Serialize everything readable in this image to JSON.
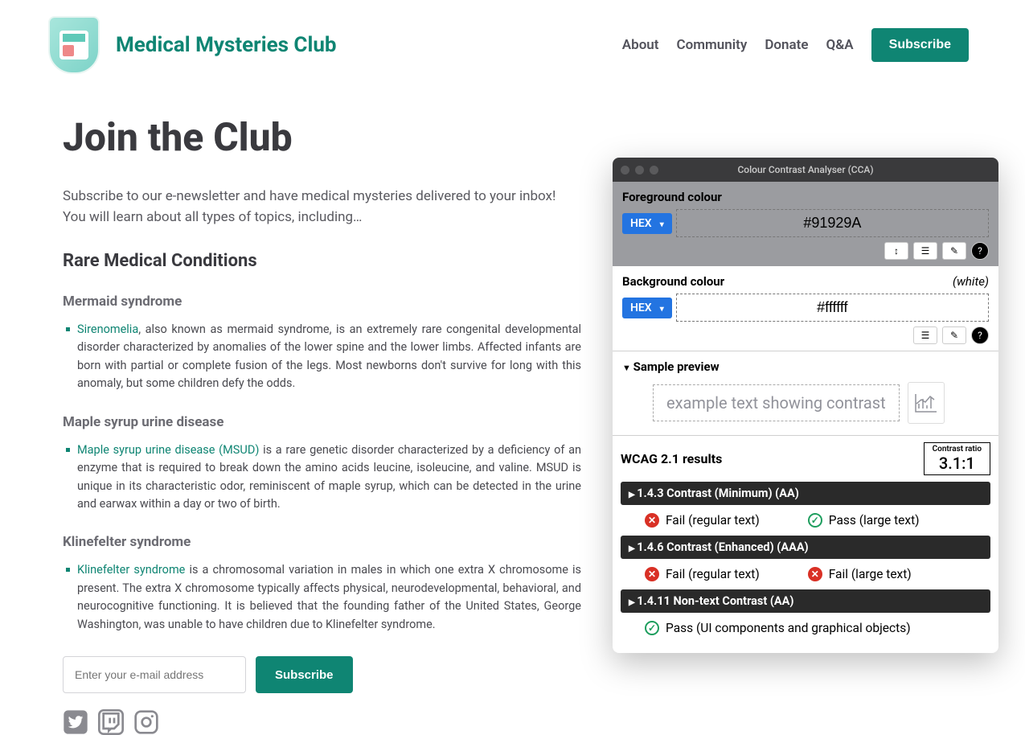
{
  "brand": {
    "name": "Medical Mysteries Club"
  },
  "nav": {
    "about": "About",
    "community": "Community",
    "donate": "Donate",
    "qa": "Q&A",
    "subscribe": "Subscribe"
  },
  "page": {
    "title": "Join the Club",
    "subtitle": "Subscribe to our e-newsletter and have medical mysteries delivered to your inbox! You will learn about all types of topics, including…",
    "section_heading": "Rare Medical Conditions"
  },
  "conditions": [
    {
      "name": "Mermaid syndrome",
      "link_text": "Sirenomelia",
      "body": ", also known as mermaid syndrome, is an extremely rare congenital developmental disorder characterized by anomalies of the lower spine and the lower limbs. Affected infants are born with partial or complete fusion of the legs. Most newborns don't survive for long with this anomaly, but some children defy the odds."
    },
    {
      "name": "Maple syrup urine disease",
      "link_text": "Maple syrup urine disease (MSUD)",
      "body": " is a rare genetic disorder characterized by a deficiency of an enzyme that is required to break down the amino acids leucine, isoleucine, and valine. MSUD is unique in its characteristic odor, reminiscent of maple syrup, which can be detected in the urine and earwax within a day or two of birth."
    },
    {
      "name": "Klinefelter syndrome",
      "link_text": "Klinefelter syndrome",
      "body": " is a chromosomal variation in males in which one extra X chromosome is present. The extra X chromosome typically affects physical, neurodevelopmental, behavioral, and neurocognitive functioning. It is believed that the founding father of the United States, George Washington, was unable to have children due to Klinefelter syndrome."
    }
  ],
  "form": {
    "email_placeholder": "Enter your e-mail address",
    "subscribe_label": "Subscribe"
  },
  "cca": {
    "window_title": "Colour Contrast Analyser (CCA)",
    "fg_label": "Foreground colour",
    "fg_format": "HEX",
    "fg_value": "#91929A",
    "bg_label": "Background colour",
    "bg_name": "(white)",
    "bg_format": "HEX",
    "bg_value": "#ffffff",
    "preview_label": "Sample preview",
    "preview_text": "example text showing contrast",
    "results_title": "WCAG 2.1 results",
    "ratio_label": "Contrast ratio",
    "ratio_value": "3.1:1",
    "rows": [
      {
        "title": "1.4.3 Contrast (Minimum) (AA)",
        "a_status": "fail",
        "a_text": "Fail (regular text)",
        "b_status": "pass",
        "b_text": "Pass (large text)"
      },
      {
        "title": "1.4.6 Contrast (Enhanced) (AAA)",
        "a_status": "fail",
        "a_text": "Fail (regular text)",
        "b_status": "fail",
        "b_text": "Fail (large text)"
      },
      {
        "title": "1.4.11 Non-text Contrast (AA)",
        "a_status": "pass",
        "a_text": "Pass (UI components and graphical objects)",
        "b_status": "",
        "b_text": ""
      }
    ]
  }
}
